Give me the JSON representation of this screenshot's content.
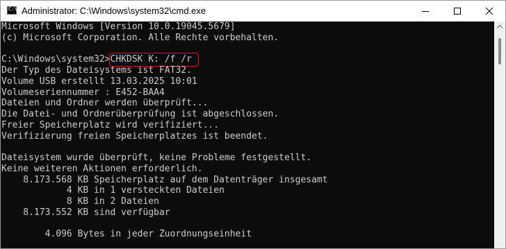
{
  "window": {
    "title": "Administrator: C:\\Windows\\system32\\cmd.exe",
    "icon": "cmd-icon",
    "controls": [
      "minimize-icon",
      "maximize-icon",
      "close-icon"
    ]
  },
  "console": {
    "lines": [
      "Microsoft Windows [Version 10.0.19045.5679]",
      "(c) Microsoft Corporation. Alle Rechte vorbehalten.",
      "",
      "",
      "Der Typ des Dateisystems ist FAT32.",
      "Volume USB erstellt 13.03.2025 10:01",
      "Volumeseriennummer : E452-BAA4",
      "Dateien und Ordner werden überprüft...",
      "Die Datei- und Ordnerüberprüfung ist abgeschlossen.",
      "Freier Speicherplatz wird verifiziert...",
      "Verifizierung freien Speicherplatzes ist beendet.",
      "",
      "Dateisystem wurde überprüft, keine Probleme festgestellt.",
      "Keine weiteren Aktionen erforderlich.",
      "    8.173.568 KB Speicherplatz auf dem Datenträger insgesamt",
      "            4 KB in 1 versteckten Dateien",
      "            8 KB in 2 Dateien",
      "    8.173.552 KB sind verfügbar",
      "",
      "        4.096 Bytes in jeder Zuordnungseinheit"
    ],
    "prompt": "C:\\Windows\\system32>",
    "command": "CHKDSK K: /f /r",
    "highlight_color": "#e81123",
    "text_color": "#cccccc",
    "background": "#0c0c0c"
  }
}
